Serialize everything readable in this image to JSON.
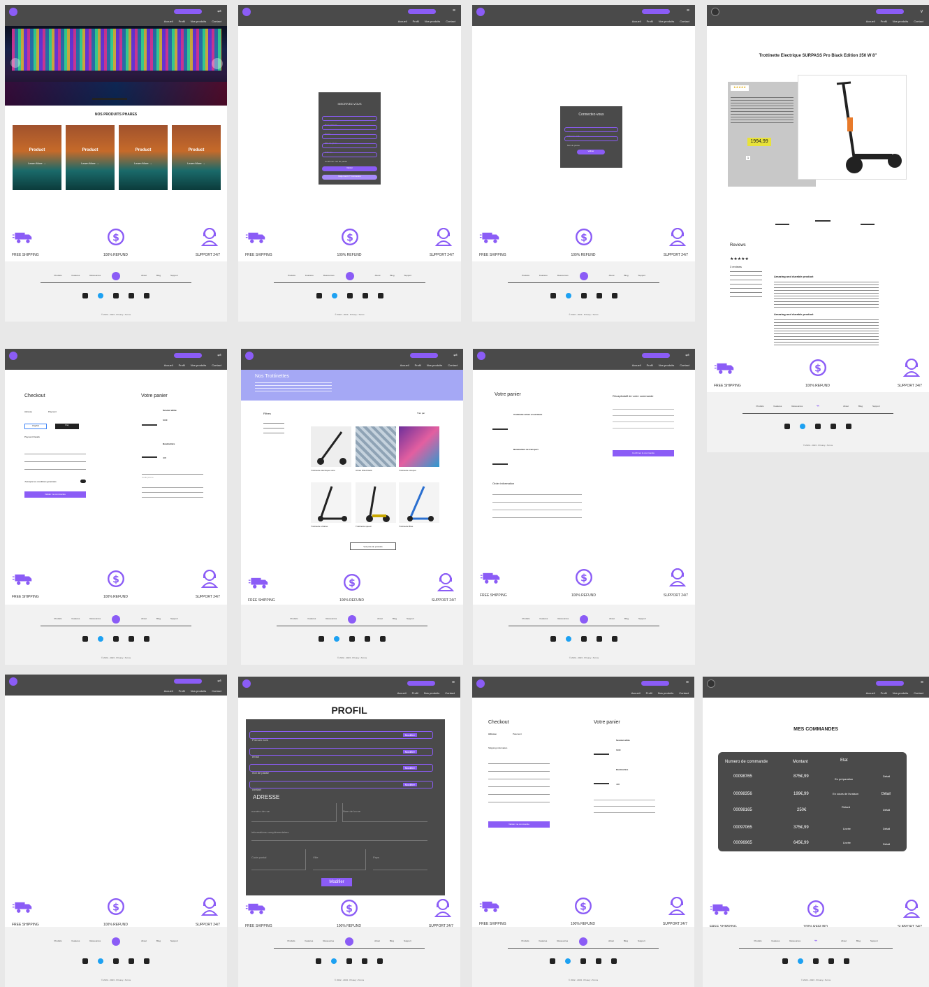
{
  "nav": {
    "links": [
      "Accueil",
      "Profil",
      "Nos produits",
      "Contact"
    ],
    "cart_icon": "cart-icon"
  },
  "features": {
    "shipping": "FREE SHIPPING",
    "refund": "100% REFUND",
    "support": "SUPPORT 24/7"
  },
  "footer": {
    "links": [
      "Produits",
      "Features",
      "Ressources",
      "About",
      "Blog",
      "Support"
    ],
    "copyright": "© 2022 - 2023 . Privacy • Terms"
  },
  "home": {
    "section_title": "NOS PRODUITS PHARES",
    "products": [
      {
        "title": "Product",
        "cta": "Learn More →"
      },
      {
        "title": "Product",
        "cta": "Learn More →"
      },
      {
        "title": "Product",
        "cta": "Learn More →"
      },
      {
        "title": "Product",
        "cta": "Learn More →"
      }
    ]
  },
  "register": {
    "title": "INSCRIVEZ-VOUS",
    "fields": [
      "Nom prénom",
      "Email",
      "Mot de passe",
      "Adresse",
      "Confirmer mot de passe"
    ],
    "submit": "Valider",
    "secondary": "Déjà inscrit ? Connexion"
  },
  "login": {
    "title": "Connectez-vous",
    "fields": [
      "Adresse mail",
      "Mot de passe"
    ],
    "submit": "Valider"
  },
  "product": {
    "title": "Trottinette Electrique SURPASS Pro Black Edition 350 W 8\"",
    "price": "1994,99",
    "stars": "★★★★★",
    "reviews_title": "Reviews",
    "reviews_count": "3 reviews",
    "review_heading": "Amazing and durable product",
    "qty": "1"
  },
  "checkout": {
    "title": "Checkout",
    "address": "Adresse",
    "payment": "Payment",
    "paypal": "PayPal",
    "pay": "Pay",
    "payment_details": "Payment Details",
    "terms": "J'accepte les conditions générales",
    "submit": "Valider ma commande"
  },
  "cart": {
    "title": "Votre panier",
    "items": [
      {
        "name": "Scooter white",
        "price": "600€"
      },
      {
        "name": "Bandoulière",
        "price": "40€"
      }
    ],
    "promo": "Code promo"
  },
  "catalog": {
    "banner_title": "Nos Trottinettes",
    "filters": "Filtres",
    "sort": "Trier par",
    "products": [
      "Trottinette électrique noire",
      "Urban Wind black",
      "Trottinette octopus",
      "Trottinette urbaine",
      "Trottinette speed",
      "Trottinette Blue"
    ],
    "more": "Voir plus de produits"
  },
  "cart2": {
    "title": "Votre panier",
    "recap": "Récapitulatif de votre commande",
    "items": [
      "Trottinette urban scout blanc",
      "Bandoulière de transport"
    ],
    "order_info": "Order information",
    "submit": "Confirmer la commande"
  },
  "profil": {
    "title": "PROFIL",
    "fields": [
      "Prénom nom",
      "email",
      "mot de passe",
      "contact"
    ],
    "edit": "Modifier",
    "address_title": "ADRESSE",
    "address_fields": [
      "numéro de rue",
      "Nom de la rue",
      "informations complémentaires",
      "Code postal",
      "Ville",
      "Pays"
    ],
    "submit": "Modifier"
  },
  "checkout2": {
    "title": "Checkout",
    "tabs": [
      "Adresse",
      "Paiement"
    ],
    "shipping": "Shipping information",
    "cart_title": "Votre panier",
    "items": [
      {
        "name": "Scooter white",
        "price": "600€"
      },
      {
        "name": "Bandoulière",
        "price": "40€"
      }
    ],
    "submit": "Valider ma commande"
  },
  "orders": {
    "title": "MES COMMANDES",
    "headers": [
      "Numero de commande",
      "Montant",
      "Etat"
    ],
    "rows": [
      {
        "num": "00098765",
        "amount": "875€,99",
        "state": "En préparation",
        "detail": "Détail"
      },
      {
        "num": "00098356",
        "amount": "199€,99",
        "state": "En cours de livraison",
        "detail": "Détail"
      },
      {
        "num": "00098165",
        "amount": "250€",
        "state": "Retard",
        "detail": "Détail"
      },
      {
        "num": "00097065",
        "amount": "375€,99",
        "state": "Livrée",
        "detail": "Détail"
      },
      {
        "num": "00096965",
        "amount": "645€,99",
        "state": "Livrée",
        "detail": "Détail"
      }
    ]
  }
}
